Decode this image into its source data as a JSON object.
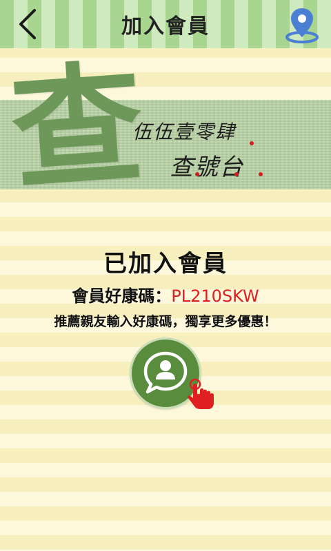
{
  "header": {
    "title": "加入會員",
    "back_icon": "chevron-left-icon",
    "map_icon": "map-pin-icon"
  },
  "banner": {
    "big_char": "查",
    "brand_line1": "伍伍壹零肆",
    "brand_line2": "查號台"
  },
  "member": {
    "joined_text": "已加入會員",
    "code_label": "會員好康碼：",
    "code_value": "PL210SKW",
    "recommend_text": "推薦親友輸入好康碼，獨享更多優惠！",
    "share_icon": "share-contact-icon",
    "tap_icon": "hand-pointer-icon"
  },
  "colors": {
    "header_green": "#a8d590",
    "button_green": "#5a8c3e",
    "code_red": "#e01e1e",
    "map_blue": "#4a7fd4"
  }
}
